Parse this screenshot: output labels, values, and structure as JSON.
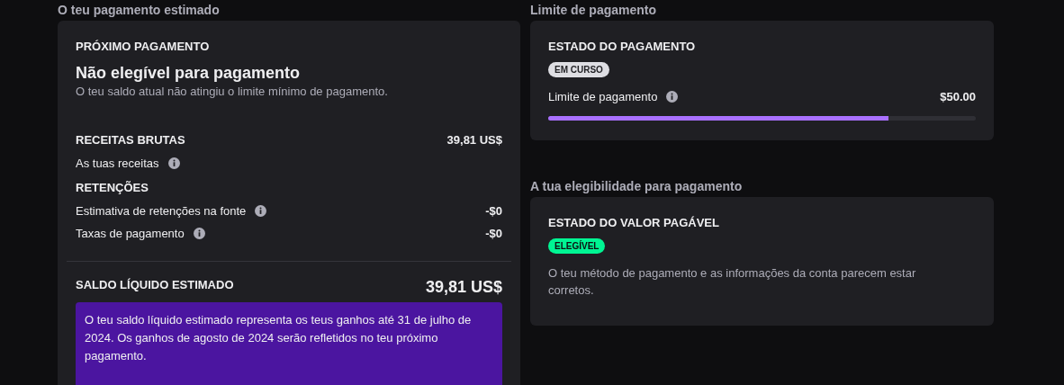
{
  "estimate": {
    "section_title": "O teu pagamento estimado",
    "eyebrow": "PRÓXIMO PAGAMENTO",
    "title": "Não elegível para pagamento",
    "subtitle": "O teu saldo atual não atingiu o limite mínimo de pagamento.",
    "rows": [
      {
        "kind": "heading",
        "label": "RECEITAS BRUTAS",
        "value": "39,81 US$"
      },
      {
        "kind": "item",
        "label": "As tuas receitas",
        "info": true
      },
      {
        "kind": "heading",
        "label": "RETENÇÕES"
      },
      {
        "kind": "item",
        "label": "Estimativa de retenções na fonte",
        "info": true,
        "value": "-$0"
      },
      {
        "kind": "item",
        "label": "Taxas de pagamento",
        "info": true,
        "value": "-$0"
      }
    ],
    "net_label": "SALDO LÍQUIDO ESTIMADO",
    "net_value": "39,81 US$",
    "notice": "O teu saldo líquido estimado representa os teus ganhos até 31 de julho de 2024. Os ganhos de agosto de 2024 serão refletidos no teu próximo pagamento."
  },
  "threshold": {
    "section_title": "Limite de pagamento",
    "eyebrow": "ESTADO DO PAGAMENTO",
    "badge": {
      "label": "EM CURSO",
      "kind": "neutral"
    },
    "label": "Limite de pagamento",
    "info": true,
    "value": "$50.00",
    "level": 0.796
  },
  "eligibility": {
    "section_title": "A tua elegibilidade para pagamento",
    "eyebrow": "ESTADO DO VALOR PAGÁVEL",
    "badge": {
      "label": "ELEGÍVEL",
      "kind": "success"
    },
    "text": "O teu método de pagamento e as informações da conta parecem estar corretos."
  }
}
